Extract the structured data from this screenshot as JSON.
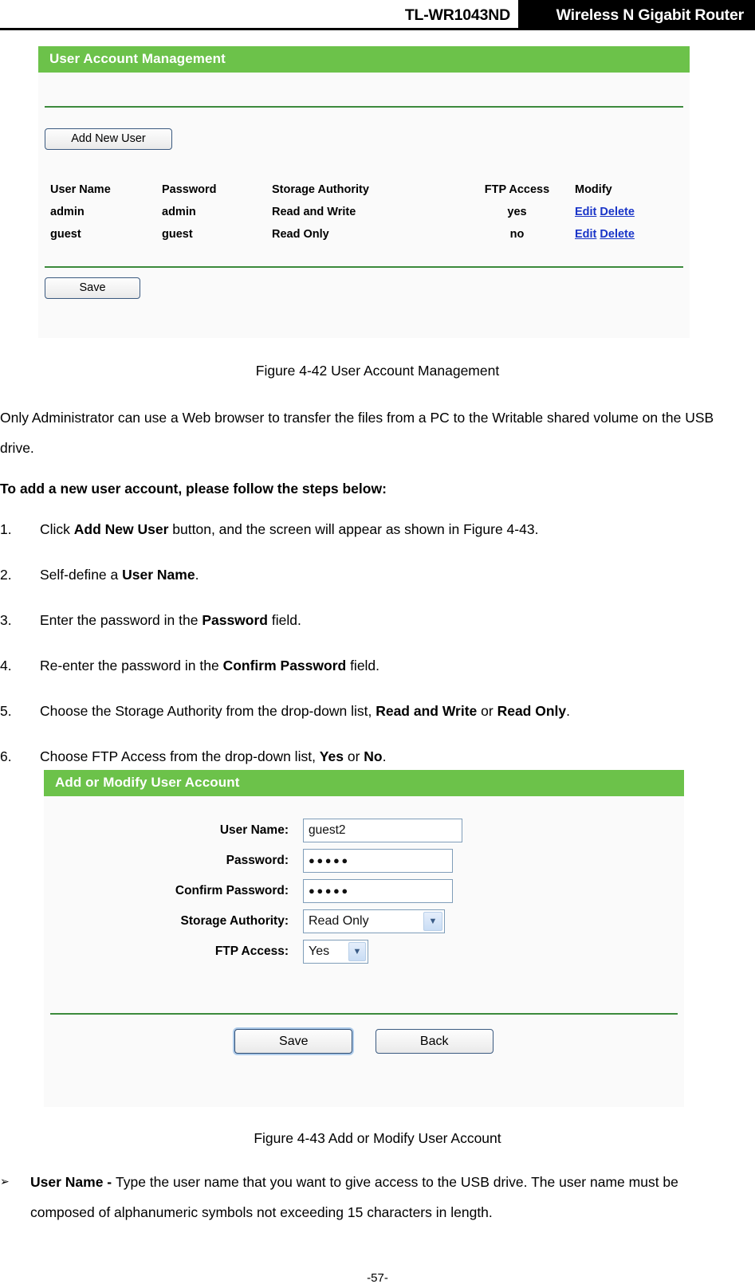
{
  "header": {
    "model": "TL-WR1043ND",
    "product": "Wireless N Gigabit Router"
  },
  "figure_account_management": {
    "panel_title": "User Account Management",
    "add_new_user_label": "Add New User",
    "save_label": "Save",
    "table": {
      "columns": [
        "User Name",
        "Password",
        "Storage Authority",
        "FTP Access",
        "Modify"
      ],
      "rows": [
        {
          "user_name": "admin",
          "password": "admin",
          "storage_authority": "Read and Write",
          "ftp_access": "yes",
          "edit": "Edit",
          "delete": "Delete"
        },
        {
          "user_name": "guest",
          "password": "guest",
          "storage_authority": "Read Only",
          "ftp_access": "no",
          "edit": "Edit",
          "delete": "Delete"
        }
      ]
    }
  },
  "caption_4_42": "Figure 4-42 User Account Management",
  "intro_paragraph": "Only Administrator can use a Web browser to transfer the files from a PC to the Writable shared volume on the USB drive.",
  "steps_heading": "To add a new user account, please follow the steps below:",
  "steps": [
    {
      "number": "1.",
      "pre": "Click ",
      "bold": "Add New User",
      "post": " button, and the screen will appear as shown in Figure 4-43."
    },
    {
      "number": "2.",
      "pre": "Self-define a ",
      "bold": "User Name",
      "post": "."
    },
    {
      "number": "3.",
      "pre": "Enter the password in the ",
      "bold": "Password",
      "post": " field."
    },
    {
      "number": "4.",
      "pre": "Re-enter the password in the ",
      "bold": "Confirm Password",
      "post": " field."
    },
    {
      "number": "5.",
      "pre": "Choose the Storage Authority from the drop-down list, ",
      "bold": "Read and Write",
      "mid": " or ",
      "bold2": "Read Only",
      "post": "."
    },
    {
      "number": "6.",
      "pre": "Choose FTP Access from the drop-down list, ",
      "bold": "Yes",
      "mid": " or ",
      "bold2": "No",
      "post": "."
    }
  ],
  "figure_add_modify": {
    "panel_title": "Add or Modify User Account",
    "fields": {
      "user_name_label": "User Name:",
      "user_name_value": "guest2",
      "password_label": "Password:",
      "password_value": "●●●●●",
      "confirm_password_label": "Confirm Password:",
      "confirm_password_value": "●●●●●",
      "storage_authority_label": "Storage Authority:",
      "storage_authority_value": "Read Only",
      "ftp_access_label": "FTP Access:",
      "ftp_access_value": "Yes"
    },
    "save_label": "Save",
    "back_label": "Back"
  },
  "caption_4_43": "Figure 4-43 Add or Modify User Account",
  "bullet_user_name": {
    "glyph": "➢",
    "bold": "User Name - ",
    "text": "Type the user name that you want to give access to the USB drive. The user name must be composed of alphanumeric symbols not exceeding 15 characters in length."
  },
  "page_number": "-57-",
  "colors": {
    "panel_header_green": "#6cc24a",
    "rule_green": "#3c8a3c",
    "link_blue": "#1a35c8",
    "panel_bg": "#fafafa",
    "input_border": "#7f9db9"
  }
}
